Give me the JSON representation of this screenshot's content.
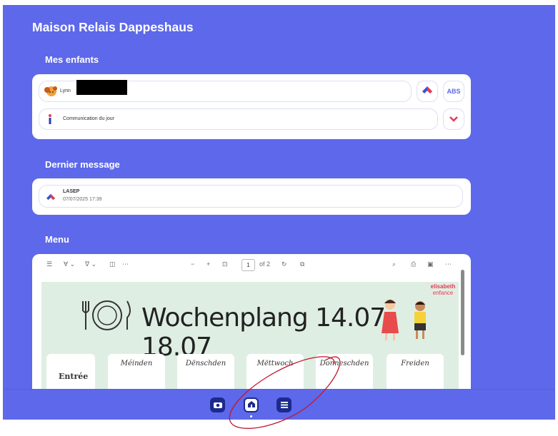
{
  "app": {
    "title": "Maison Relais Dappeshaus"
  },
  "sections": {
    "children": "Mes enfants",
    "last_message": "Dernier message",
    "menu": "Menu"
  },
  "child": {
    "name": "Lynn",
    "abs_label": "ABS",
    "communication": "Communication du jour"
  },
  "message": {
    "sender": "LASEP",
    "datetime": "07/07/2025 17:39"
  },
  "viewer": {
    "page_current": "1",
    "page_total": "of 2",
    "heading": "Wochenplang 14.07- 18.07",
    "logo_line1": "elisabeth",
    "logo_line2": "enfance",
    "first_row_label": "Entrée",
    "days": [
      "Méinden",
      "Dënschden",
      "Mëttwoch",
      "Donneschden",
      "Freiden"
    ]
  },
  "colors": {
    "brand": "#5d68ea",
    "nav_dark": "#1c2a8e",
    "doc_bg": "#dfeee3"
  },
  "icons": [
    "school-roof-icon",
    "info-icon",
    "chevron-down-icon",
    "camera-icon",
    "home-icon",
    "menu-list-icon"
  ]
}
